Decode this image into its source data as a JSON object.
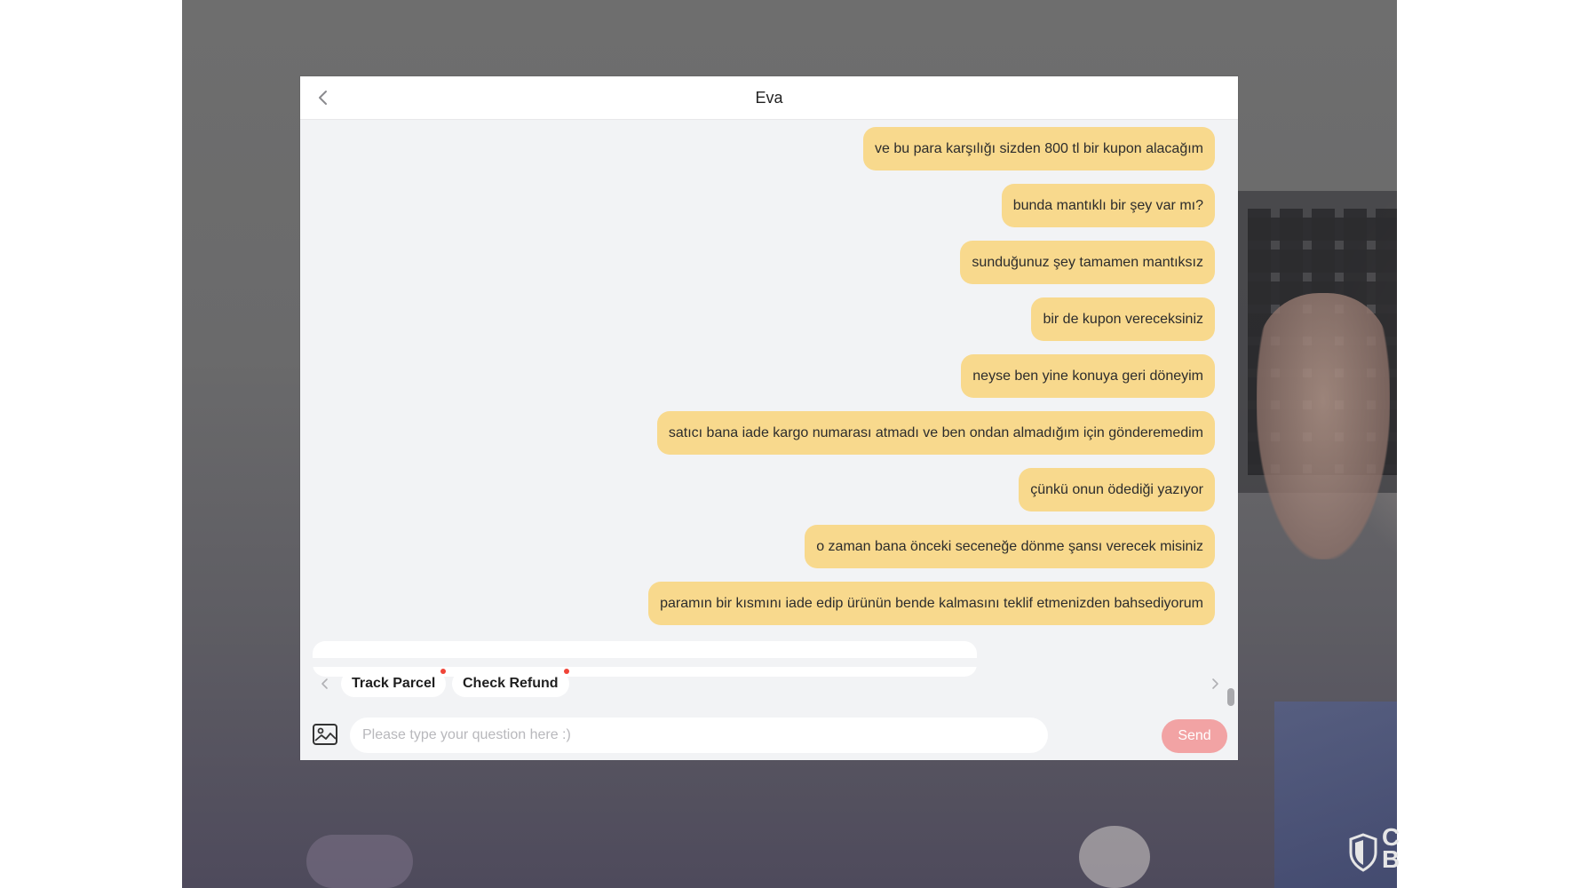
{
  "header": {
    "title": "Eva",
    "back_icon": "chevron-left-icon"
  },
  "messages": [
    {
      "sender": "user",
      "text": "ve  bu para karşılığı sizden 800 tl bir kupon alacağım"
    },
    {
      "sender": "user",
      "text": "bunda mantıklı  bir şey var mı?"
    },
    {
      "sender": "user",
      "text": "sunduğunuz şey tamamen mantıksız"
    },
    {
      "sender": "user",
      "text": "bir de kupon vereceksiniz"
    },
    {
      "sender": "user",
      "text": "neyse ben yine konuya geri döneyim"
    },
    {
      "sender": "user",
      "text": "satıcı bana iade kargo numarası atmadı ve ben ondan almadığım için gönderemedim"
    },
    {
      "sender": "user",
      "text": "çünkü onun ödediği yazıyor"
    },
    {
      "sender": "user",
      "text": "o zaman bana önceki seceneğe dönme şansı verecek misiniz"
    },
    {
      "sender": "user",
      "text": "paramın bir kısmını iade edip ürünün bende kalmasını teklif etmenizden bahsediyorum"
    }
  ],
  "partial_reply": "",
  "quick_actions": [
    {
      "label": "Track Parcel",
      "badge": true
    },
    {
      "label": "Check Refund",
      "badge": true
    }
  ],
  "composer": {
    "placeholder": "Please type your question here :)",
    "send_label": "Send",
    "image_icon": "image-upload-icon"
  },
  "colors": {
    "user_bubble": "#f8d98d",
    "send_button": "#f2a3a4",
    "badge": "#f04438",
    "chat_background": "#f2f3f5"
  }
}
